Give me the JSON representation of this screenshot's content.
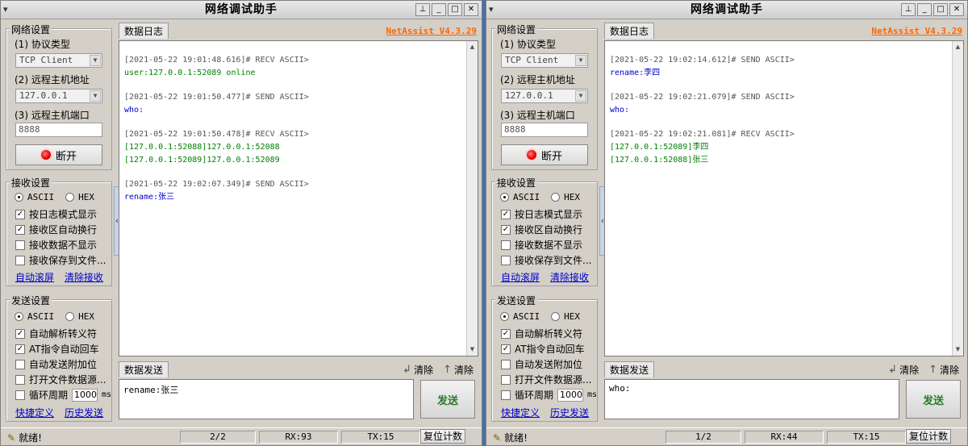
{
  "windows": [
    {
      "title": "网络调试助手",
      "sysmenu": "▾",
      "brand": "NetAssist V4.3.29",
      "net_settings": {
        "group_label": "网络设置",
        "protocol_label": "(1) 协议类型",
        "protocol_value": "TCP Client",
        "host_label": "(2) 远程主机地址",
        "host_value": "127.0.0.1",
        "port_label": "(3) 远程主机端口",
        "port_value": "8888",
        "connect_label": "断开"
      },
      "recv_settings": {
        "group_label": "接收设置",
        "ascii": "ASCII",
        "hex": "HEX",
        "options": [
          "按日志模式显示",
          "接收区自动换行",
          "接收数据不显示",
          "接收保存到文件..."
        ],
        "link_autoscroll": "自动滚屏",
        "link_clear": "清除接收"
      },
      "send_settings": {
        "group_label": "发送设置",
        "ascii": "ASCII",
        "hex": "HEX",
        "options": [
          "自动解析转义符",
          "AT指令自动回车",
          "自动发送附加位",
          "打开文件数据源..."
        ],
        "cycle_label": "循环周期",
        "cycle_value": "1000",
        "cycle_unit": "ms",
        "link_shortcut": "快捷定义",
        "link_history": "历史发送"
      },
      "log_tab": "数据日志",
      "log": [
        {
          "header": "[2021-05-22 19:01:48.616]# RECV ASCII>",
          "type": "recv",
          "lines": [
            "user:127.0.0.1:52089 online"
          ]
        },
        {
          "header": "[2021-05-22 19:01:50.477]# SEND ASCII>",
          "type": "send",
          "lines": [
            "who:"
          ]
        },
        {
          "header": "[2021-05-22 19:01:50.478]# RECV ASCII>",
          "type": "recv",
          "lines": [
            "[127.0.0.1:52088]127.0.0.1:52088",
            "[127.0.0.1:52089]127.0.0.1:52089"
          ]
        },
        {
          "header": "[2021-05-22 19:02:07.349]# SEND ASCII>",
          "type": "send",
          "lines": [
            "rename:张三"
          ]
        }
      ],
      "send_tab": "数据发送",
      "clear1": "清除",
      "clear2": "清除",
      "send_text": "rename:张三",
      "send_button": "发送",
      "status": {
        "ready": "就绪!",
        "count": "2/2",
        "rx": "RX:93",
        "tx": "TX:15",
        "reset": "复位计数"
      }
    },
    {
      "title": "网络调试助手",
      "sysmenu": "▾",
      "brand": "NetAssist V4.3.29",
      "net_settings": {
        "group_label": "网络设置",
        "protocol_label": "(1) 协议类型",
        "protocol_value": "TCP Client",
        "host_label": "(2) 远程主机地址",
        "host_value": "127.0.0.1",
        "port_label": "(3) 远程主机端口",
        "port_value": "8888",
        "connect_label": "断开"
      },
      "recv_settings": {
        "group_label": "接收设置",
        "ascii": "ASCII",
        "hex": "HEX",
        "options": [
          "按日志模式显示",
          "接收区自动换行",
          "接收数据不显示",
          "接收保存到文件..."
        ],
        "link_autoscroll": "自动滚屏",
        "link_clear": "清除接收"
      },
      "send_settings": {
        "group_label": "发送设置",
        "ascii": "ASCII",
        "hex": "HEX",
        "options": [
          "自动解析转义符",
          "AT指令自动回车",
          "自动发送附加位",
          "打开文件数据源..."
        ],
        "cycle_label": "循环周期",
        "cycle_value": "1000",
        "cycle_unit": "ms",
        "link_shortcut": "快捷定义",
        "link_history": "历史发送"
      },
      "log_tab": "数据日志",
      "log": [
        {
          "header": "[2021-05-22 19:02:14.612]# SEND ASCII>",
          "type": "send",
          "lines": [
            "rename:李四"
          ]
        },
        {
          "header": "[2021-05-22 19:02:21.079]# SEND ASCII>",
          "type": "send",
          "lines": [
            "who:"
          ]
        },
        {
          "header": "[2021-05-22 19:02:21.081]# RECV ASCII>",
          "type": "recv",
          "lines": [
            "[127.0.0.1:52089]李四",
            "[127.0.0.1:52088]张三"
          ]
        }
      ],
      "send_tab": "数据发送",
      "clear1": "清除",
      "clear2": "清除",
      "send_text": "who:",
      "send_button": "发送",
      "status": {
        "ready": "就绪!",
        "count": "1/2",
        "rx": "RX:44",
        "tx": "TX:15",
        "reset": "复位计数"
      }
    }
  ]
}
